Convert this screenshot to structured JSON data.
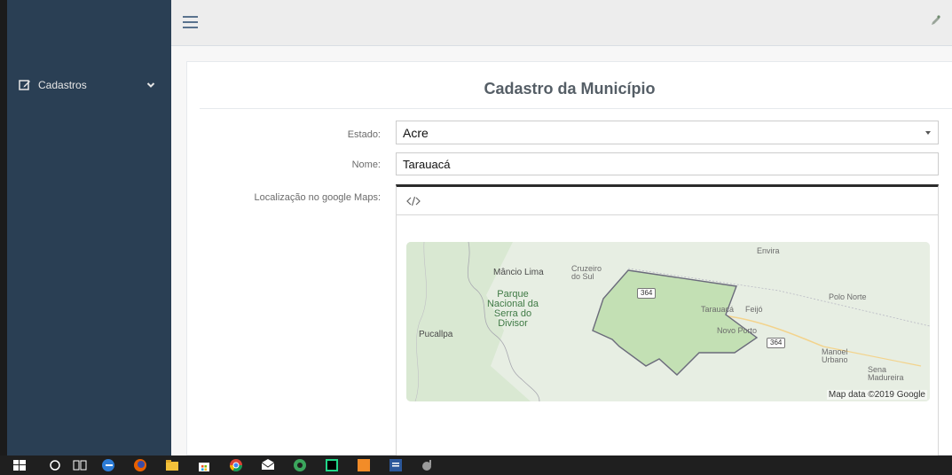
{
  "sidebar": {
    "items": [
      {
        "label": "Cadastros",
        "icon": "edit-icon"
      }
    ]
  },
  "topnav": {
    "menu_icon": "hamburger-icon",
    "user_icon": "user-icon"
  },
  "form": {
    "title": "Cadastro da Município",
    "estado": {
      "label": "Estado:",
      "value": "Acre"
    },
    "nome": {
      "label": "Nome:",
      "value": "Tarauacá"
    },
    "localizacao": {
      "label": "Localização no google Maps:"
    },
    "editor": {
      "toolbar_icon": "code-icon",
      "toolbar_text": "</>"
    }
  },
  "map": {
    "labels": {
      "envira": "Envira",
      "mancio_lima": "Mâncio Lima",
      "cruzeiro_do_sul": "Cruzeiro do Sul",
      "parque": "Parque Nacional da Serra do Divisor",
      "pucallpa": "Pucallpa",
      "tarauaca": "Tarauacá",
      "feijo": "Feijó",
      "novo_porto": "Novo Porto",
      "polo_norte": "Polo Norte",
      "manoel_urbano": "Manoel Urbano",
      "sena_madureira": "Sena Madureira",
      "road_1": "364",
      "road_2": "364"
    },
    "attribution": "Map data ©2019 Google",
    "colors": {
      "region_fill": "#c3e0b4",
      "region_border": "#6b6b7b",
      "road": "#f3d38c",
      "background": "#e7eee3"
    }
  },
  "taskbar": {
    "icons": [
      "windows-start-icon",
      "search-icon",
      "task-view-icon",
      "edge-icon",
      "firefox-icon",
      "file-explorer-icon",
      "store-icon",
      "chrome-icon",
      "mail-icon",
      "app-icon",
      "pycharm-icon",
      "app-orange-icon",
      "word-icon",
      "app-misc-icon"
    ]
  }
}
